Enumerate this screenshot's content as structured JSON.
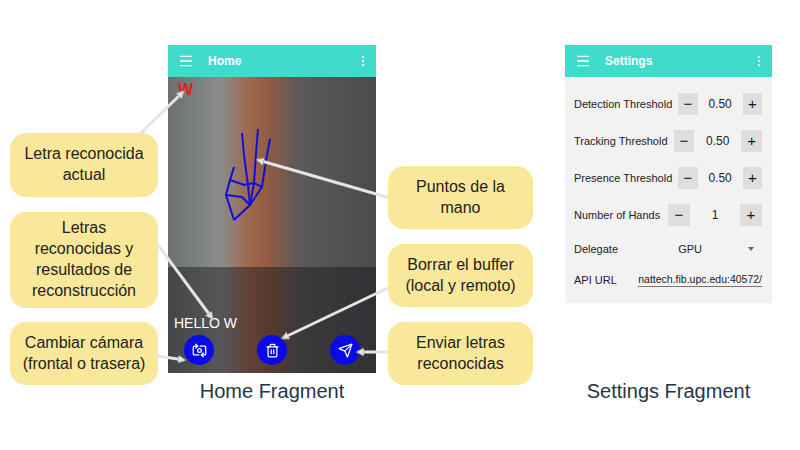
{
  "home": {
    "title": "Home",
    "current_letter": "W",
    "buffer_text": "HELLO W",
    "caption": "Home Fragment"
  },
  "callouts": [
    {
      "text": "Letra reconocida actual"
    },
    {
      "text": "Letras reconocidas y resultados de reconstrucción"
    },
    {
      "text": "Cambiar cámara (frontal o trasera)"
    },
    {
      "text": "Puntos de la mano"
    },
    {
      "text": "Borrar el buffer (local y remoto)"
    },
    {
      "text": "Enviar letras reconocidas"
    }
  ],
  "settings": {
    "title": "Settings",
    "caption": "Settings Fragment",
    "minus": "−",
    "plus": "+",
    "rows": [
      {
        "kind": "stepper",
        "label": "Detection Threshold",
        "value": "0.50"
      },
      {
        "kind": "stepper",
        "label": "Tracking Threshold",
        "value": "0.50"
      },
      {
        "kind": "stepper",
        "label": "Presence Threshold",
        "value": "0.50"
      },
      {
        "kind": "stepper",
        "label": "Number of Hands",
        "value": "1"
      },
      {
        "kind": "select",
        "label": "Delegate",
        "value": "GPU"
      },
      {
        "kind": "text",
        "label": "API URL",
        "value": "nattech.fib.upc.edu:40572/"
      }
    ]
  }
}
